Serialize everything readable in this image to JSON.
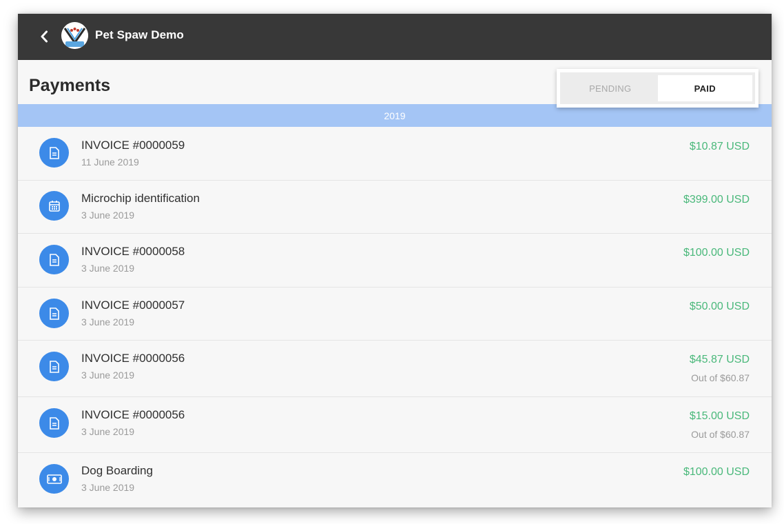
{
  "header": {
    "app_name": "Pet Spaw Demo",
    "logo_text": "PET SPAW"
  },
  "page": {
    "title": "Payments"
  },
  "tabs": [
    {
      "label": "PENDING",
      "active": false
    },
    {
      "label": "PAID",
      "active": true
    }
  ],
  "year_label": "2019",
  "payments": [
    {
      "title": "INVOICE #0000059",
      "date": "11 June 2019",
      "amount": "$10.87 USD",
      "out_of": "",
      "icon": "document-icon"
    },
    {
      "title": "Microchip identification",
      "date": "3 June 2019",
      "amount": "$399.00 USD",
      "out_of": "",
      "icon": "calendar-icon"
    },
    {
      "title": "INVOICE #0000058",
      "date": "3 June 2019",
      "amount": "$100.00 USD",
      "out_of": "",
      "icon": "document-icon"
    },
    {
      "title": "INVOICE #0000057",
      "date": "3 June 2019",
      "amount": "$50.00 USD",
      "out_of": "",
      "icon": "document-icon"
    },
    {
      "title": "INVOICE #0000056",
      "date": "3 June 2019",
      "amount": "$45.87 USD",
      "out_of": "Out of $60.87",
      "icon": "document-icon"
    },
    {
      "title": "INVOICE #0000056",
      "date": "3 June 2019",
      "amount": "$15.00 USD",
      "out_of": "Out of $60.87",
      "icon": "document-icon"
    },
    {
      "title": "Dog Boarding",
      "date": "3 June 2019",
      "amount": "$100.00 USD",
      "out_of": "",
      "icon": "cash-icon"
    }
  ],
  "colors": {
    "topbar": "#383838",
    "accent_blue": "#3c8ae8",
    "year_bar": "#a4c5f5",
    "amount_green": "#49b87a"
  }
}
